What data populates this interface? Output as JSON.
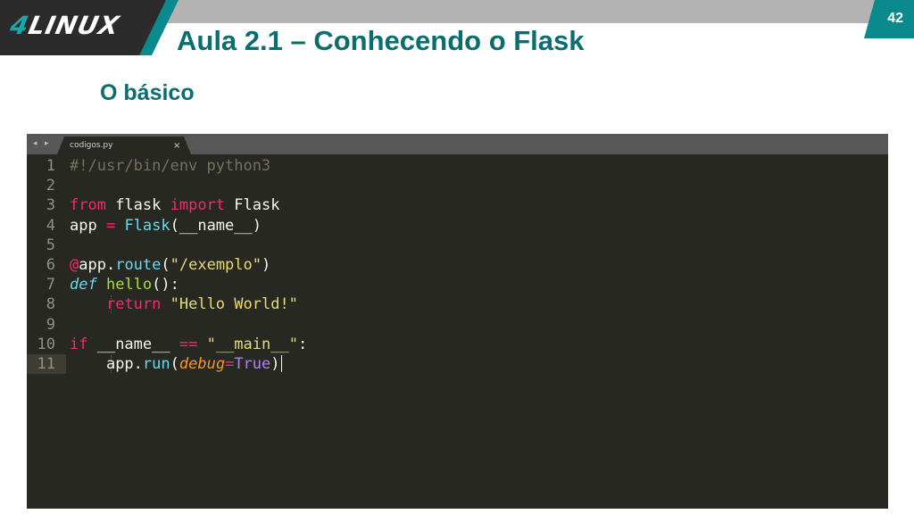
{
  "logo": {
    "four": "4",
    "rest": "LINUX"
  },
  "page_number": "42",
  "title": "Aula 2.1 – Conhecendo o Flask",
  "subtitle": "O básico",
  "editor": {
    "nav_arrows": "◂ ▸",
    "tab_name": "codigos.py",
    "tab_close": "×",
    "line_numbers": [
      "1",
      "2",
      "3",
      "4",
      "5",
      "6",
      "7",
      "8",
      "9",
      "10",
      "11"
    ],
    "code": {
      "l1": "#!/usr/bin/env python3",
      "l3_from": "from",
      "l3_mod": " flask ",
      "l3_import": "import",
      "l3_cls": " Flask",
      "l4_app": "app ",
      "l4_eq": "=",
      "l4_fn": " Flask",
      "l4_rest": "(__name__)",
      "l6_at": "@",
      "l6_app": "app.",
      "l6_route": "route",
      "l6_open": "(",
      "l6_str": "\"/exemplo\"",
      "l6_close": ")",
      "l7_def": "def",
      "l7_sp": " ",
      "l7_name": "hello",
      "l7_rest": "():",
      "l8_indent": "    ",
      "l8_ret": "return",
      "l8_sp": " ",
      "l8_str": "\"Hello World!\"",
      "l10_if": "if",
      "l10_name": " __name__ ",
      "l10_eq": "==",
      "l10_sp": " ",
      "l10_str": "\"__main__\"",
      "l10_colon": ":",
      "l11_indent": "    ",
      "l11_app": "app.",
      "l11_run": "run",
      "l11_open": "(",
      "l11_debug": "debug",
      "l11_eq": "=",
      "l11_true": "True",
      "l11_close": ")"
    }
  }
}
